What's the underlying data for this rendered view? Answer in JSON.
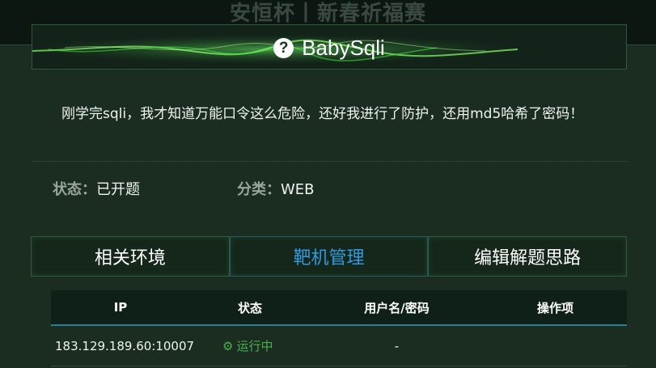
{
  "background_title": "安恒杯丨新春祈福赛",
  "challenge": {
    "title": "BabySqli",
    "description": "刚学完sqli，我才知道万能口令这么危险，还好我进行了防护，还用md5哈希了密码！"
  },
  "meta": {
    "status_label": "状态：",
    "status_value": "已开题",
    "category_label": "分类：",
    "category_value": "WEB"
  },
  "tabs": [
    {
      "label": "相关环境"
    },
    {
      "label": "靶机管理"
    },
    {
      "label": "编辑解题思路"
    }
  ],
  "active_tab": 1,
  "table": {
    "headers": [
      "IP",
      "状态",
      "用户名/密码",
      "操作项"
    ],
    "rows": [
      {
        "ip": "183.129.189.60:10007",
        "status": "运行中",
        "credentials": "-",
        "actions": ""
      }
    ]
  },
  "colors": {
    "accent_green": "#4caf50",
    "active_tab_blue": "#2e9be0"
  },
  "icons": {
    "header": "help-circle-icon",
    "status": "gear-icon"
  }
}
